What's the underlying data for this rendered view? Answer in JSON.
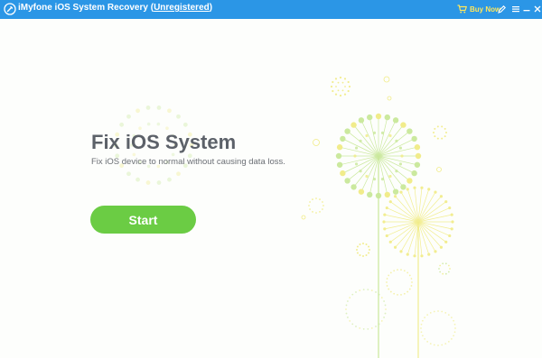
{
  "titlebar": {
    "app_name": "iMyfone iOS System Recovery",
    "open_paren": " (",
    "registration_status": "Unregistered",
    "close_paren": ")",
    "buy_now_label": "Buy Now",
    "buy_icon": "shopping-cart-icon",
    "feedback_icon": "feedback-icon",
    "menu_icon": "menu-icon",
    "minimize_icon": "minimize-icon",
    "close_icon": "close-icon"
  },
  "main": {
    "heading": "Fix iOS System",
    "subtitle": "Fix iOS device to normal without causing data loss.",
    "start_label": "Start"
  },
  "colors": {
    "titlebar_bg": "#2b96e6",
    "buy_now": "#ffe75c",
    "start_button": "#6bcc44",
    "heading": "#5c6169",
    "decoration_green": "#c9e89a",
    "decoration_yellow": "#f1ec86"
  }
}
